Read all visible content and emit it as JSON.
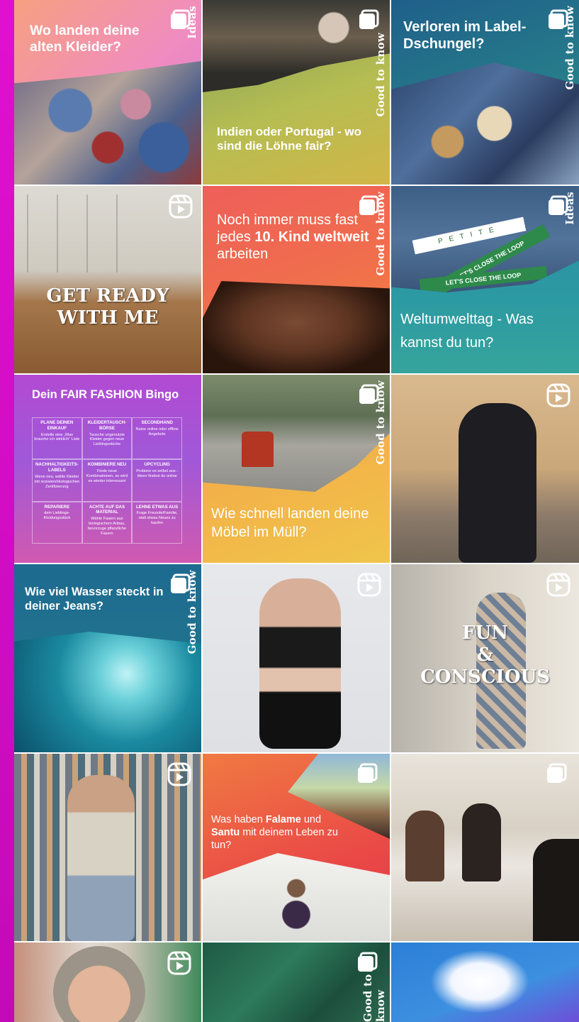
{
  "posts": [
    {
      "title": "Wo landen deine alten Kleider?",
      "tag": "Ideas",
      "type": "carousel"
    },
    {
      "title": "Indien oder Portugal - wo sind die Löhne fair?",
      "tag": "Good to know",
      "type": "carousel"
    },
    {
      "title": "Verloren im Label-Dschungel?",
      "tag": "Good to know",
      "type": "carousel"
    },
    {
      "title": "GET READY WITH ME",
      "type": "reel"
    },
    {
      "title_parts": [
        "Noch immer muss fast jedes ",
        "10. Kind weltweit",
        " arbeiten"
      ],
      "tag": "Good to know",
      "type": "carousel"
    },
    {
      "title": "Weltumwelttag - Was kannst du tun?",
      "tag": "Ideas",
      "labels": [
        "PETITE",
        "LET'S CLOSE THE LOOP",
        "LET'S CLOSE THE LOOP"
      ],
      "type": "carousel"
    },
    {
      "title": "Dein FAIR FASHION Bingo",
      "type": "carousel",
      "bingo": [
        {
          "head": "PLANE DEINEN EINKAUF",
          "body": "Erstelle eine „Was brauche ich wirklich“ Liste"
        },
        {
          "head": "KLEIDERTAUSCH-BÖRSE",
          "body": "Tausche ungenutzte Kleider gegen neue Lieblingsstücke"
        },
        {
          "head": "SECONDHAND",
          "body": "Nutze online oder offline Angebote"
        },
        {
          "head": "NACHHALTIGKEITS-LABELS",
          "body": "Wenn neu, wähle Kleider mit sozialen/ökologischen Zertifizierung"
        },
        {
          "head": "KOMBINIERE NEU",
          "body": "Finde neue Kombinationen, so wird es wieder interessant"
        },
        {
          "head": "UPCYCLING",
          "body": "Probiere es selbst aus - Ideen findest du online"
        },
        {
          "head": "REPARIERE",
          "body": "dein Lieblings-Kleidungsstück"
        },
        {
          "head": "ACHTE AUF DAS MATERIAL",
          "body": "Wähle Fasern aus biologischem Anbau, bevorzuge pflanzliche Fasern"
        },
        {
          "head": "LEHNE ETWAS AUS",
          "body": "Frage Freunde/Familie, statt etwas Neues zu kaufen"
        }
      ]
    },
    {
      "title": "Wie schnell landen deine Möbel im Müll?",
      "tag": "Good to know",
      "type": "carousel"
    },
    {
      "title": "",
      "type": "reel"
    },
    {
      "title": "Wie viel Wasser steckt in deiner Jeans?",
      "tag": "Good to know",
      "type": "carousel"
    },
    {
      "title": "",
      "type": "reel"
    },
    {
      "title_lines": [
        "FUN",
        "&",
        "CONSCIOUS"
      ],
      "type": "reel"
    },
    {
      "title": "",
      "type": "reel"
    },
    {
      "title_parts": [
        "Was haben ",
        "Falame",
        " und ",
        "Santu",
        " mit deinem Leben zu tun?"
      ],
      "type": "carousel"
    },
    {
      "title": "",
      "type": "carousel"
    },
    {
      "title": "",
      "type": "reel"
    },
    {
      "tag": "Good to know",
      "type": "carousel"
    },
    {
      "title": "",
      "type": "image"
    }
  ],
  "colors": {
    "frame": "#d30fc7",
    "white": "#ffffff"
  }
}
